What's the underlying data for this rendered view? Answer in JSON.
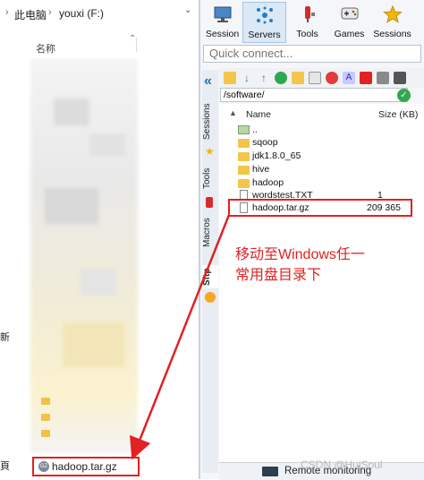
{
  "explorer": {
    "breadcrumb": [
      "此电脑",
      "youxi (F:)"
    ],
    "column_header": "名称",
    "left_fragments": [
      "新",
      "頁"
    ],
    "highlighted_file": "hadoop.tar.gz"
  },
  "moba": {
    "toolbar": [
      {
        "label": "Session",
        "icon": "monitor-icon"
      },
      {
        "label": "Servers",
        "icon": "servers-icon"
      },
      {
        "label": "Tools",
        "icon": "tools-icon"
      },
      {
        "label": "Games",
        "icon": "gamepad-icon"
      },
      {
        "label": "Sessions",
        "icon": "star-icon"
      }
    ],
    "quick_connect_placeholder": "Quick connect...",
    "side_tabs": [
      "Sessions",
      "Tools",
      "Macros",
      "Sftp"
    ],
    "path": "/software/",
    "list_header": {
      "name": "Name",
      "size": "Size (KB)"
    },
    "files": [
      {
        "name": "..",
        "size": "",
        "icon": "parent-folder-icon"
      },
      {
        "name": "sqoop",
        "size": "",
        "icon": "folder-icon"
      },
      {
        "name": "jdk1.8.0_65",
        "size": "",
        "icon": "folder-icon"
      },
      {
        "name": "hive",
        "size": "",
        "icon": "folder-icon"
      },
      {
        "name": "hadoop",
        "size": "",
        "icon": "folder-icon"
      },
      {
        "name": "wordstest.TXT",
        "size": "1",
        "icon": "text-file-icon"
      },
      {
        "name": "hadoop.tar.gz",
        "size": "209 365",
        "icon": "archive-file-icon"
      }
    ],
    "remote_monitoring": "Remote monitoring"
  },
  "annotation": {
    "text_line1": "移动至Windows任一",
    "text_line2": "常用盘目录下"
  },
  "watermark": "CSDN @HuiSoul",
  "colors": {
    "annotation": "#e02222",
    "accent": "#2ea84f"
  }
}
